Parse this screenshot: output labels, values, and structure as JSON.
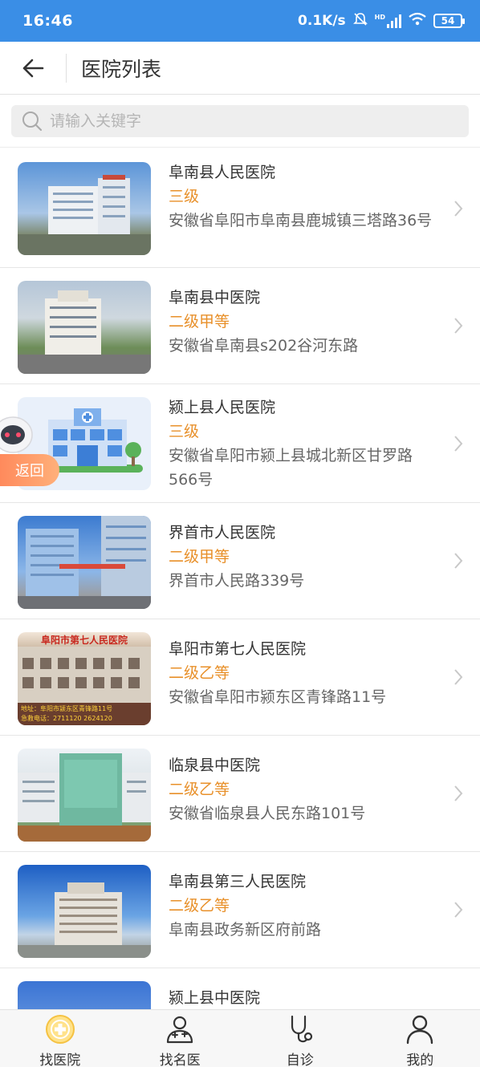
{
  "status_bar": {
    "time": "16:46",
    "net_speed": "0.1K/s",
    "hd": "HD",
    "battery": "54"
  },
  "header": {
    "title": "医院列表"
  },
  "search": {
    "placeholder": "请输入关键字",
    "value": ""
  },
  "hospitals": [
    {
      "name": "阜南县人民医院",
      "level": "三级",
      "address": "安徽省阜阳市阜南县鹿城镇三塔路36号"
    },
    {
      "name": "阜南县中医院",
      "level": "二级甲等",
      "address": "安徽省阜南县s202谷河东路"
    },
    {
      "name": "颍上县人民医院",
      "level": "三级",
      "address": "安徽省阜阳市颍上县城北新区甘罗路566号"
    },
    {
      "name": "界首市人民医院",
      "level": "二级甲等",
      "address": "界首市人民路339号"
    },
    {
      "name": "阜阳市第七人民医院",
      "level": "二级乙等",
      "address": "安徽省阜阳市颍东区青锋路11号"
    },
    {
      "name": "临泉县中医院",
      "level": "二级乙等",
      "address": "安徽省临泉县人民东路101号"
    },
    {
      "name": "阜南县第三人民医院",
      "level": "二级乙等",
      "address": "阜南县政务新区府前路"
    },
    {
      "name": "颍上县中医院",
      "level": "",
      "address": ""
    }
  ],
  "photo_text": {
    "seventh_hospital_sign": "阜阳市第七人民医院",
    "seventh_hospital_caption_1": "地址：阜阳市颍东区青锋路11号",
    "seventh_hospital_caption_2": "急救电话：2711120 2624120"
  },
  "float_back": {
    "label": "返回"
  },
  "tabbar": {
    "tabs": [
      {
        "label": "找医院"
      },
      {
        "label": "找名医"
      },
      {
        "label": "自诊"
      },
      {
        "label": "我的"
      }
    ]
  },
  "colors": {
    "status_bar": "#3a8ee6",
    "level": "#e8902a",
    "tab_active_icon": "#f5c242"
  }
}
